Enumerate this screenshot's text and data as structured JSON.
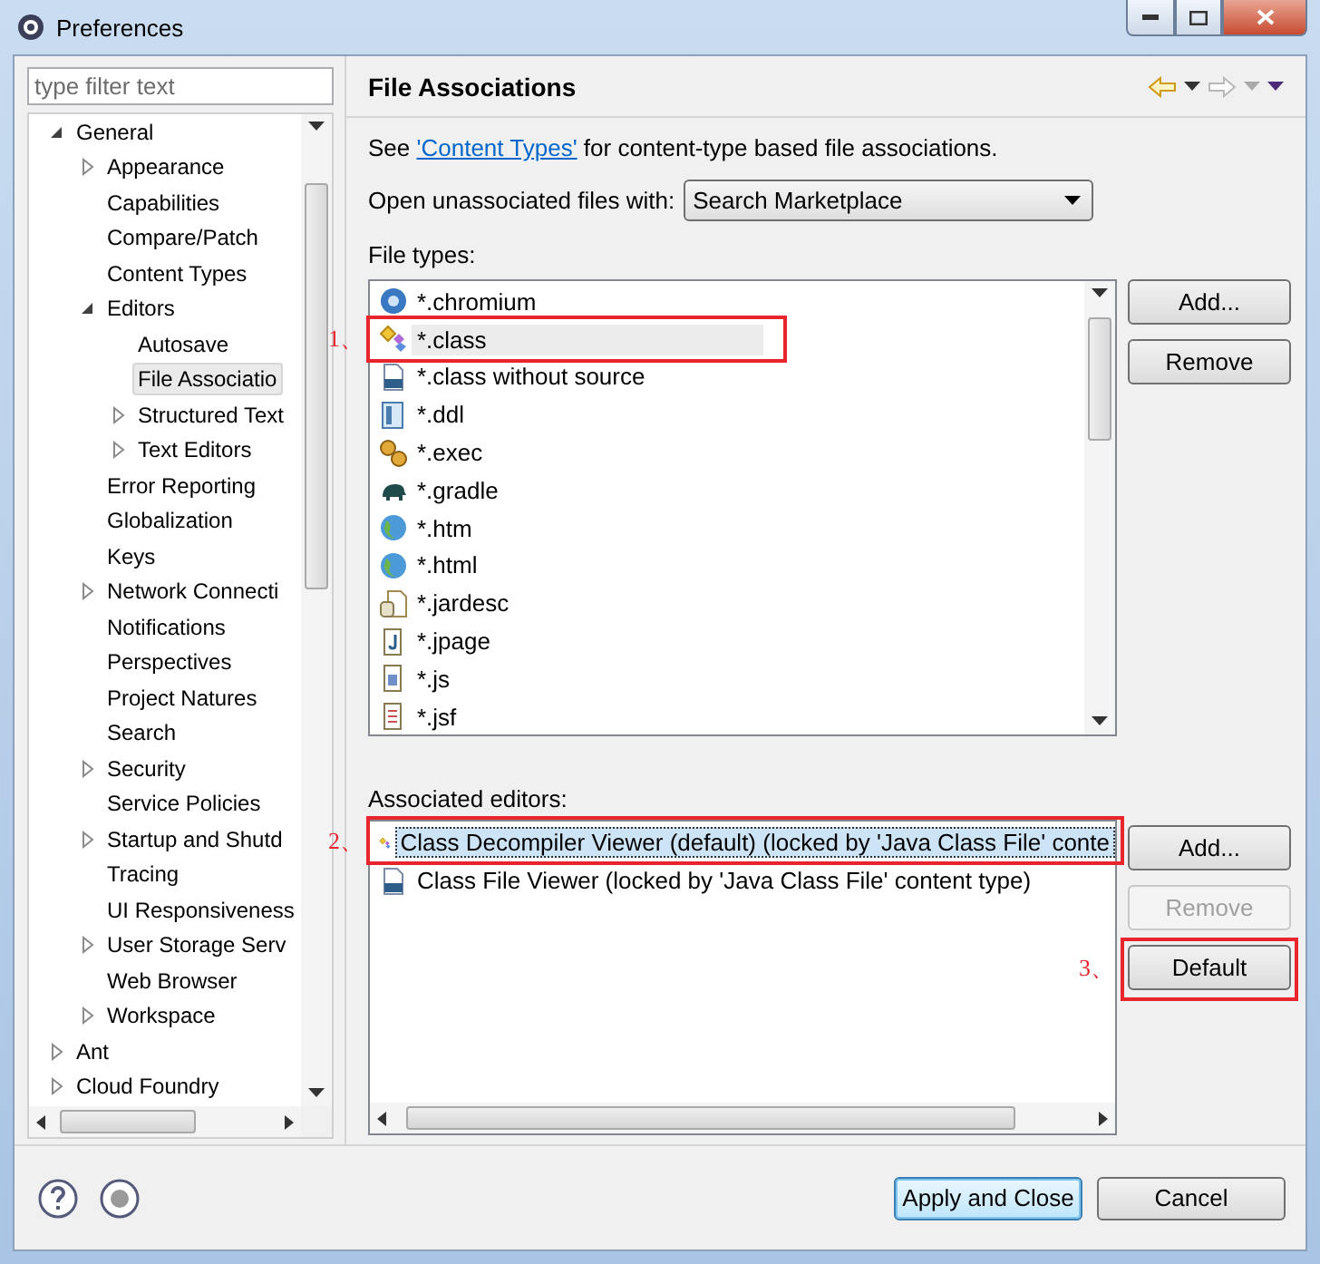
{
  "window": {
    "title": "Preferences"
  },
  "filter": {
    "placeholder": "type filter text"
  },
  "tree": [
    {
      "label": "General",
      "selected": false,
      "expanded": true,
      "children": [
        {
          "label": "Appearance",
          "selected": false,
          "expanded": false
        },
        {
          "label": "Capabilities",
          "selected": false
        },
        {
          "label": "Compare/Patch",
          "selected": false
        },
        {
          "label": "Content Types",
          "selected": false
        },
        {
          "label": "Editors",
          "selected": false,
          "expanded": true,
          "children": [
            {
              "label": "Autosave",
              "selected": false
            },
            {
              "label": "File Associatio",
              "selected": true
            },
            {
              "label": "Structured Text",
              "selected": false,
              "expanded": false
            },
            {
              "label": "Text Editors",
              "selected": false,
              "expanded": false
            }
          ]
        },
        {
          "label": "Error Reporting",
          "selected": false
        },
        {
          "label": "Globalization",
          "selected": false
        },
        {
          "label": "Keys",
          "selected": false
        },
        {
          "label": "Network Connecti",
          "selected": false,
          "expanded": false
        },
        {
          "label": "Notifications",
          "selected": false
        },
        {
          "label": "Perspectives",
          "selected": false
        },
        {
          "label": "Project Natures",
          "selected": false
        },
        {
          "label": "Search",
          "selected": false
        },
        {
          "label": "Security",
          "selected": false,
          "expanded": false
        },
        {
          "label": "Service Policies",
          "selected": false
        },
        {
          "label": "Startup and Shutd",
          "selected": false,
          "expanded": false
        },
        {
          "label": "Tracing",
          "selected": false
        },
        {
          "label": "UI Responsiveness",
          "selected": false
        },
        {
          "label": "User Storage Serv",
          "selected": false,
          "expanded": false
        },
        {
          "label": "Web Browser",
          "selected": false
        },
        {
          "label": "Workspace",
          "selected": false,
          "expanded": false
        }
      ]
    },
    {
      "label": "Ant",
      "selected": false,
      "expanded": false
    },
    {
      "label": "Cloud Foundry",
      "selected": false,
      "expanded": false
    }
  ],
  "page": {
    "title": "File Associations",
    "intro": {
      "before": "See ",
      "link": "'Content Types'",
      "after": " for content-type based file associations."
    },
    "open_with": {
      "label": "Open unassociated files with:",
      "value": "Search Marketplace"
    },
    "file_types": {
      "label": "File types:",
      "items": [
        {
          "label": "*.chromium",
          "kind": "browser",
          "selected": false
        },
        {
          "label": "*.class",
          "kind": "class",
          "selected": true,
          "callout": "1、"
        },
        {
          "label": "*.class without source",
          "kind": "binary",
          "selected": false
        },
        {
          "label": "*.ddl",
          "kind": "ddl",
          "selected": false
        },
        {
          "label": "*.exec",
          "kind": "gears",
          "selected": false
        },
        {
          "label": "*.gradle",
          "kind": "elephant",
          "selected": false
        },
        {
          "label": "*.htm",
          "kind": "globe",
          "selected": false
        },
        {
          "label": "*.html",
          "kind": "globe",
          "selected": false
        },
        {
          "label": "*.jardesc",
          "kind": "jar",
          "selected": false
        },
        {
          "label": "*.jpage",
          "kind": "jpage",
          "selected": false
        },
        {
          "label": "*.js",
          "kind": "js",
          "selected": false
        },
        {
          "label": "*.jsf",
          "kind": "doc",
          "selected": false
        }
      ],
      "buttons": [
        {
          "label": "Add...",
          "disabled": false
        },
        {
          "label": "Remove",
          "disabled": false
        }
      ]
    },
    "editors": {
      "label": "Associated editors:",
      "callout": "2、",
      "items": [
        {
          "label": "Class Decompiler Viewer (default) (locked by 'Java Class File' conte",
          "kind": "class",
          "selected": true
        },
        {
          "label": "Class File Viewer (locked by 'Java Class File' content type)",
          "kind": "binary",
          "selected": false
        }
      ],
      "buttons": [
        {
          "label": "Add...",
          "disabled": false
        },
        {
          "label": "Remove",
          "disabled": true
        },
        {
          "label": "Default",
          "disabled": false,
          "callout": "3、"
        }
      ]
    }
  },
  "footer": {
    "buttons": [
      {
        "label": "Apply and Close",
        "default": true
      },
      {
        "label": "Cancel",
        "default": false
      }
    ]
  }
}
